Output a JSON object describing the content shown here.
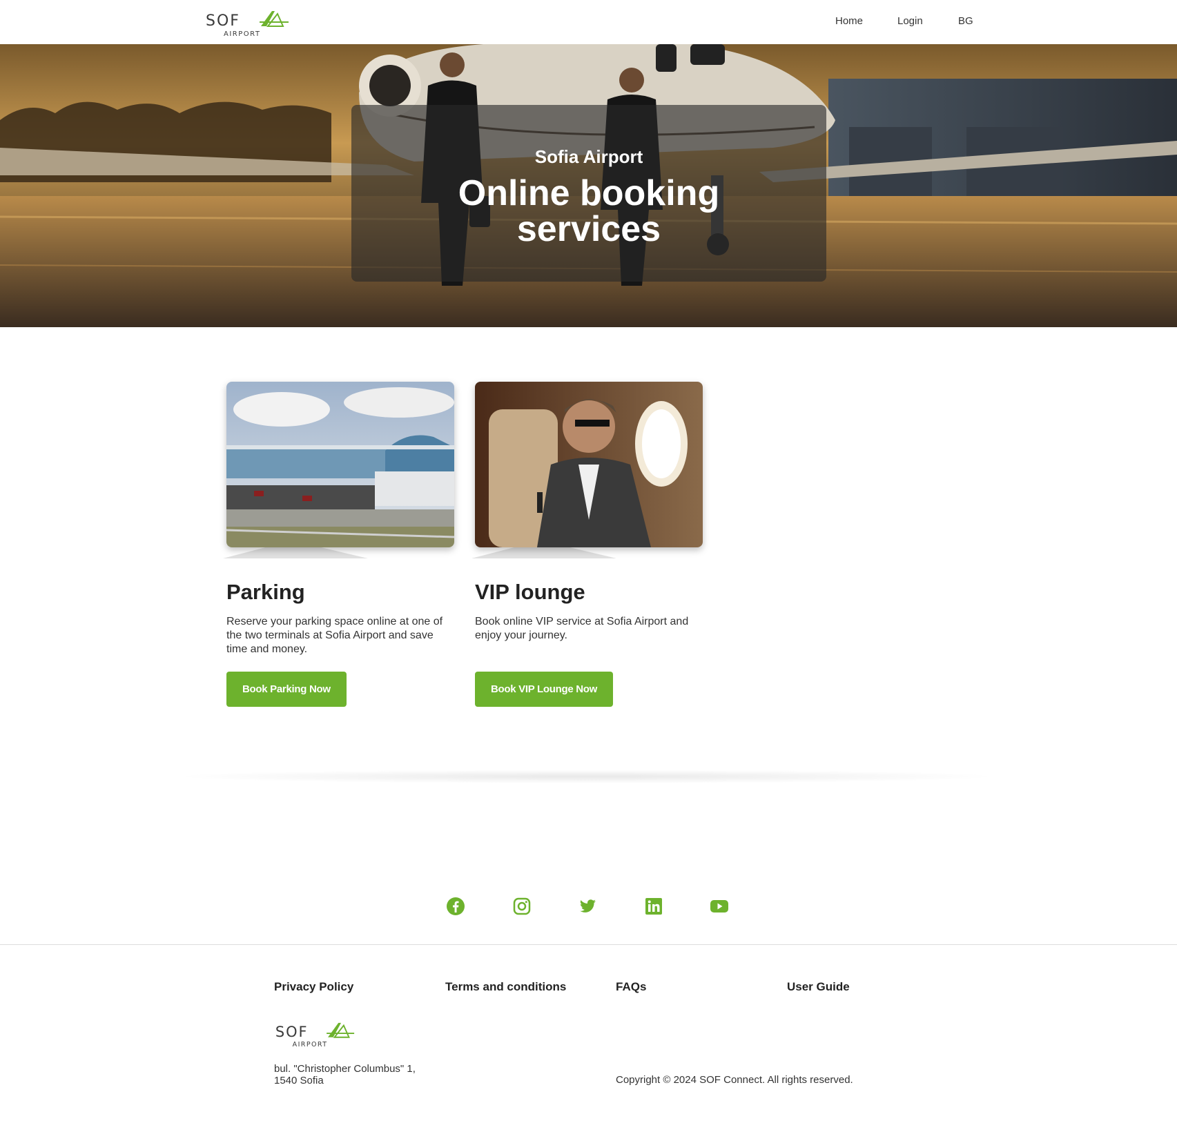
{
  "header": {
    "logo_word": "SOFIA",
    "logo_sub": "AIRPORT",
    "nav": [
      {
        "label": "Home"
      },
      {
        "label": "Login"
      },
      {
        "label": "BG"
      }
    ]
  },
  "hero": {
    "subtitle": "Sofia Airport",
    "title_line1": "Online booking",
    "title_line2": "services"
  },
  "cards": [
    {
      "title": "Parking",
      "text": "Reserve your parking space online at one of the two terminals at Sofia Airport and save time and money.",
      "button": "Book Parking Now",
      "image_icon": "airport-terminal-photo"
    },
    {
      "title": "VIP lounge",
      "text": "Book online VIP service at Sofia Airport and enjoy your journey.",
      "button": "Book VIP Lounge Now",
      "image_icon": "vip-passenger-photo"
    }
  ],
  "social": [
    {
      "icon": "facebook-icon"
    },
    {
      "icon": "instagram-icon"
    },
    {
      "icon": "twitter-icon"
    },
    {
      "icon": "linkedin-icon"
    },
    {
      "icon": "youtube-icon"
    }
  ],
  "footer": {
    "links": [
      {
        "label": "Privacy Policy"
      },
      {
        "label": "Terms and conditions"
      },
      {
        "label": "FAQs"
      },
      {
        "label": "User Guide"
      }
    ],
    "address_line1": "bul. \"Christopher Columbus\" 1,",
    "address_line2": "1540 Sofia",
    "copyright": "Copyright © 2024 SOF Connect. All rights reserved."
  },
  "colors": {
    "accent": "#6db22d",
    "text": "#2b2b2b"
  }
}
